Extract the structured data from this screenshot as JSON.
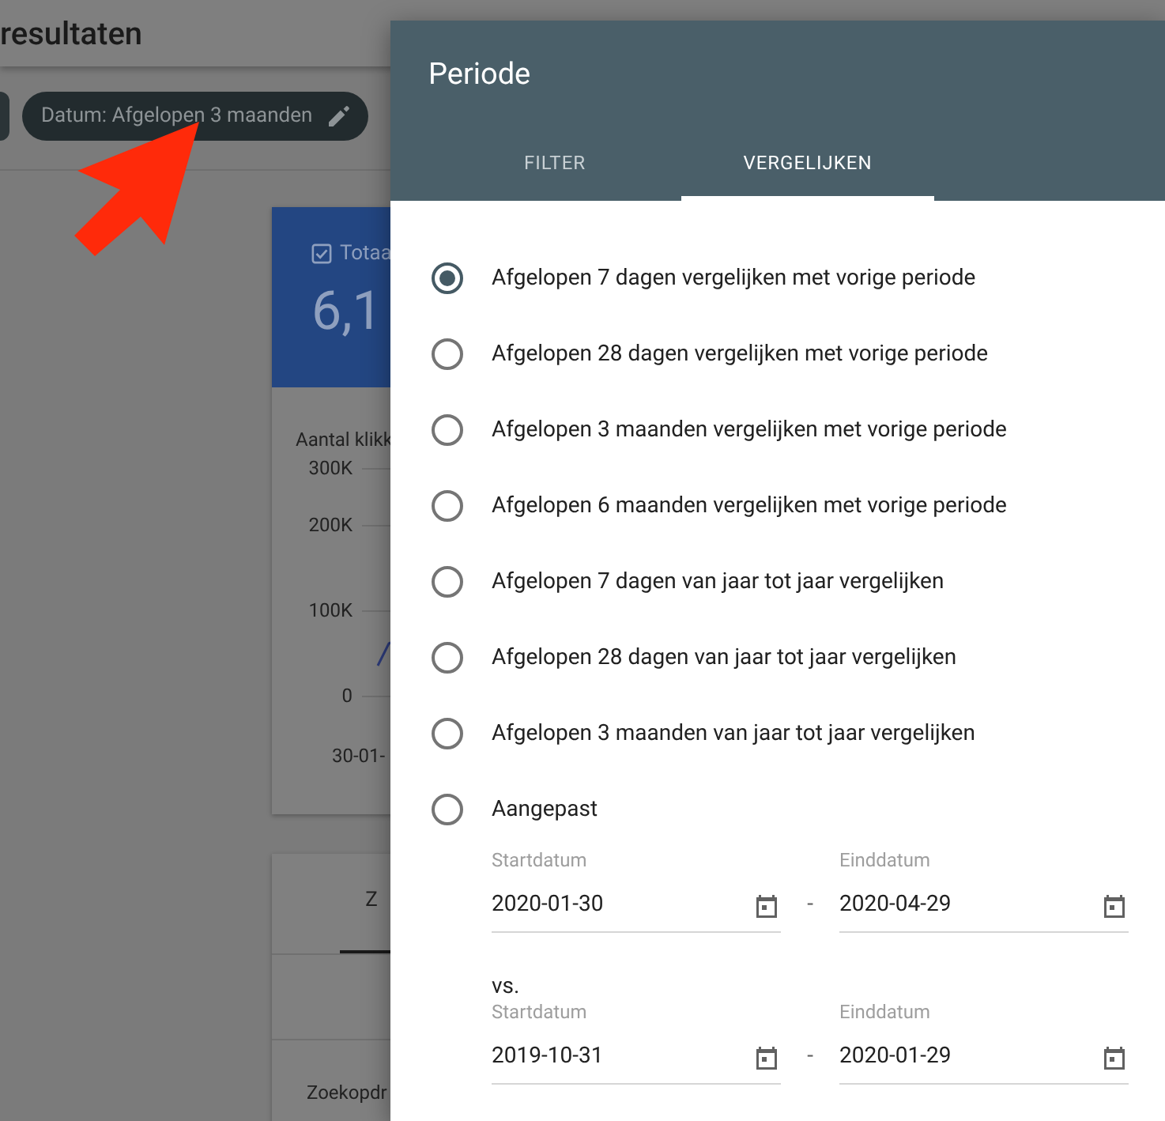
{
  "page": {
    "title": "resultaten",
    "date_chip": "Datum: Afgelopen 3 maanden"
  },
  "card": {
    "metric_label": "Totaa",
    "checked": true,
    "value": "6,1",
    "chart_title": "Aantal klikk",
    "yticks": [
      "300K",
      "200K",
      "100K",
      "0"
    ],
    "xlabel": "30-01-"
  },
  "card2": {
    "tab": "Z",
    "column": "Zoekopdr"
  },
  "dialog": {
    "title": "Periode",
    "tabs": [
      {
        "label": "FILTER",
        "selected": false
      },
      {
        "label": "VERGELIJKEN",
        "selected": true
      }
    ],
    "options": [
      {
        "label": "Afgelopen 7 dagen vergelijken met vorige periode",
        "selected": true
      },
      {
        "label": "Afgelopen 28 dagen vergelijken met vorige periode",
        "selected": false
      },
      {
        "label": "Afgelopen 3 maanden vergelijken met vorige periode",
        "selected": false
      },
      {
        "label": "Afgelopen 6 maanden vergelijken met vorige periode",
        "selected": false
      },
      {
        "label": "Afgelopen 7 dagen van jaar tot jaar vergelijken",
        "selected": false
      },
      {
        "label": "Afgelopen 28 dagen van jaar tot jaar vergelijken",
        "selected": false
      },
      {
        "label": "Afgelopen 3 maanden van jaar tot jaar vergelijken",
        "selected": false
      },
      {
        "label": "Aangepast",
        "selected": false
      }
    ],
    "ranges": [
      {
        "start": {
          "label": "Startdatum",
          "value": "2020-01-30"
        },
        "separator": "-",
        "end": {
          "label": "Einddatum",
          "value": "2020-04-29"
        }
      },
      {
        "prefix": "vs.",
        "start": {
          "label": "Startdatum",
          "value": "2019-10-31"
        },
        "separator": "-",
        "end": {
          "label": "Einddatum",
          "value": "2020-01-29"
        }
      }
    ]
  }
}
